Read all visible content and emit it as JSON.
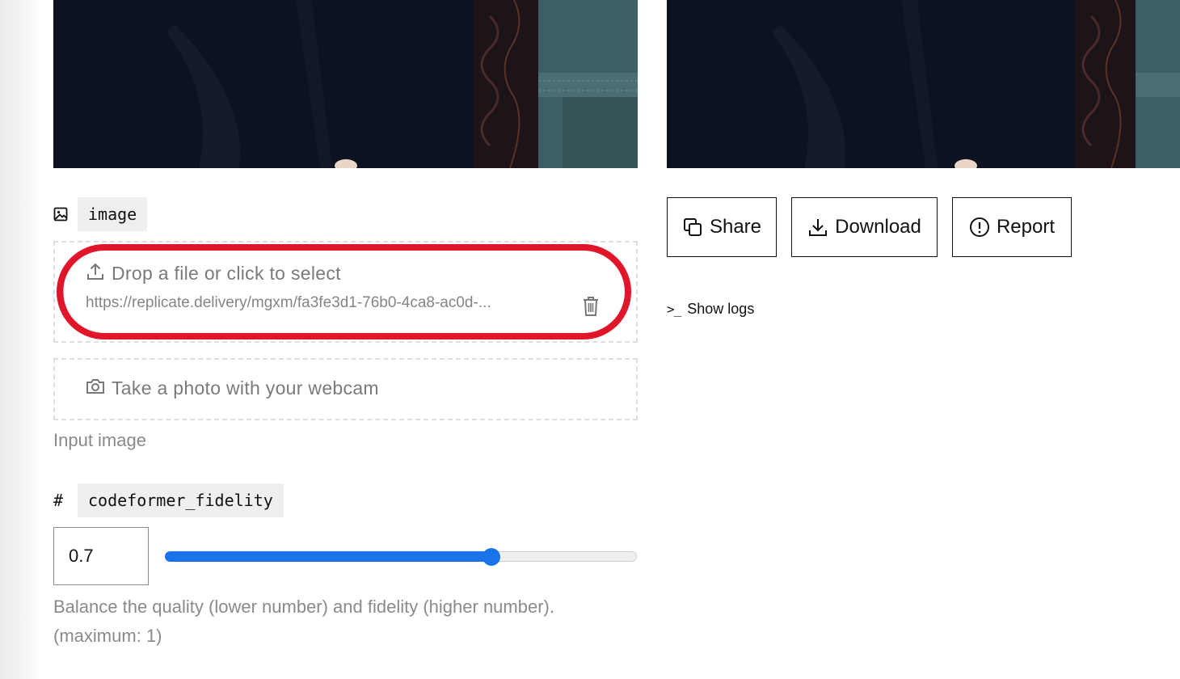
{
  "inputs": {
    "image": {
      "label": "image",
      "icon": "image-icon",
      "dropzone_title": "Drop a file or click to select",
      "file_url": "https://replicate.delivery/mgxm/fa3fe3d1-76b0-4ca8-ac0d-...",
      "webcam_label": "Take a photo with your webcam",
      "help": "Input image"
    },
    "codeformer_fidelity": {
      "label": "codeformer_fidelity",
      "icon_glyph": "#",
      "value": "0.7",
      "slider_value": 0.7,
      "slider_min": 0,
      "slider_max": 1,
      "help_line1": "Balance the quality (lower number) and fidelity (higher number).",
      "help_line2": "(maximum: 1)"
    }
  },
  "output": {
    "share_label": "Share",
    "download_label": "Download",
    "report_label": "Report",
    "logs_prompt": ">_",
    "show_logs_label": "Show logs"
  },
  "colors": {
    "accent": "#1a73e8",
    "annotation": "#e0162b",
    "muted_text": "#8a8a8a"
  }
}
